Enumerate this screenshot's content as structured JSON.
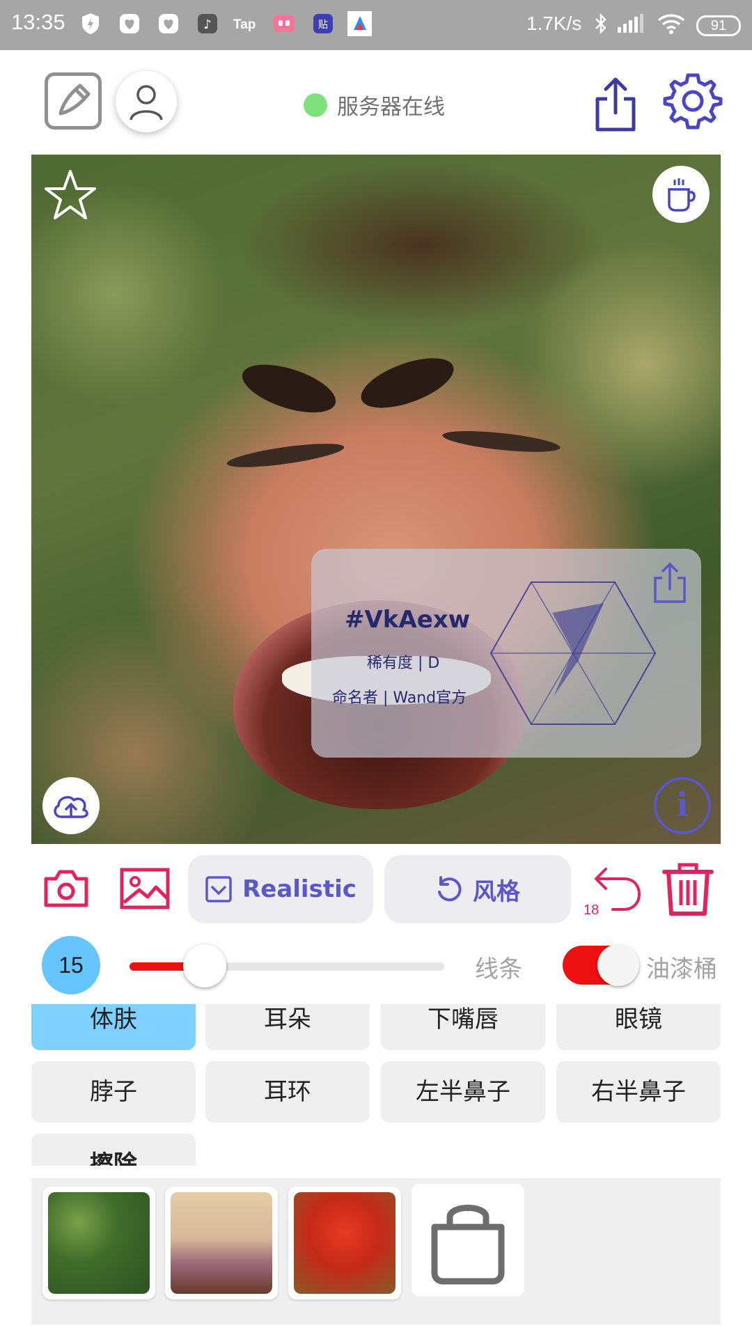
{
  "status_bar": {
    "time": "13:35",
    "net_speed": "1.7K/s",
    "battery": "91"
  },
  "toolbar": {
    "server_status": "服务器在线",
    "server_status_color": "#7fe17a"
  },
  "canvas": {
    "card": {
      "code": "#VkAexw",
      "rarity": "稀有度 | D",
      "namer": "命名者 | Wand官方"
    }
  },
  "controls": {
    "realistic_label": "Realistic",
    "style_label": "风格",
    "undo_count": "18"
  },
  "brush": {
    "size": "15",
    "slider_fraction": 0.24,
    "mode_line": "线条",
    "mode_bucket": "油漆桶",
    "bucket_enabled": true
  },
  "parts": [
    {
      "label": "体肤",
      "selected": true
    },
    {
      "label": "耳朵",
      "selected": false
    },
    {
      "label": "下嘴唇",
      "selected": false
    },
    {
      "label": "眼镜",
      "selected": false
    },
    {
      "label": "脖子",
      "selected": false
    },
    {
      "label": "耳环",
      "selected": false
    },
    {
      "label": "左半鼻子",
      "selected": false
    },
    {
      "label": "右半鼻子",
      "selected": false
    },
    {
      "label": "擦除",
      "selected": false
    }
  ],
  "thumbnails": [
    "texture-green",
    "texture-pink",
    "texture-red"
  ],
  "colors": {
    "accent": "#5b57c7",
    "danger": "#e0245e",
    "selected_part": "#7fd0ff",
    "slider": "#ee1111"
  }
}
